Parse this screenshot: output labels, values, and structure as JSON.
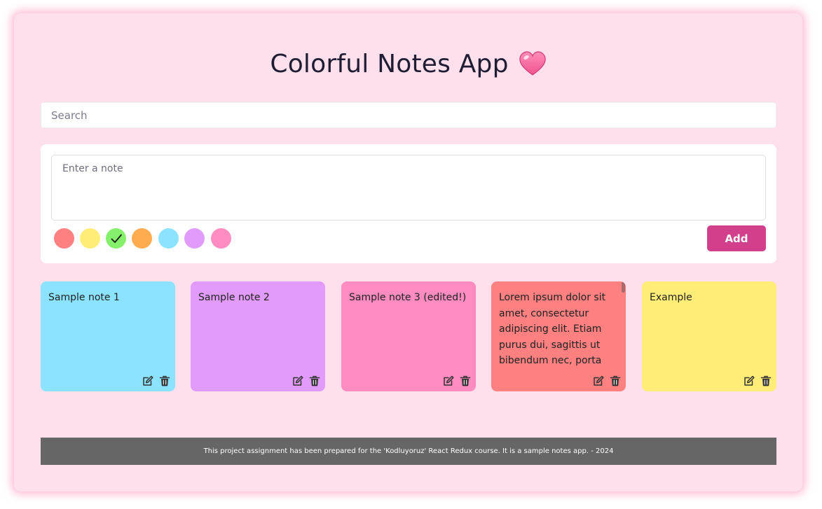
{
  "app": {
    "title": "Colorful Notes App"
  },
  "search": {
    "placeholder": "Search",
    "value": ""
  },
  "composer": {
    "placeholder": "Enter a note",
    "value": "",
    "add_label": "Add",
    "add_color": "#d23f8a",
    "colors": [
      {
        "name": "red",
        "hex": "#ff8080",
        "selected": false
      },
      {
        "name": "yellow",
        "hex": "#ffed78",
        "selected": false
      },
      {
        "name": "green",
        "hex": "#85f06b",
        "selected": true
      },
      {
        "name": "orange",
        "hex": "#ffab4f",
        "selected": false
      },
      {
        "name": "blue",
        "hex": "#8ce3ff",
        "selected": false
      },
      {
        "name": "purple",
        "hex": "#e09bfb",
        "selected": false
      },
      {
        "name": "pink",
        "hex": "#ff8cc1",
        "selected": false
      }
    ]
  },
  "notes": [
    {
      "text": "Sample note 1",
      "color": "#8ce3ff"
    },
    {
      "text": "Sample note 2",
      "color": "#e09bfb"
    },
    {
      "text": "Sample note 3 (edited!)",
      "color": "#ff8cc1"
    },
    {
      "text": "Lorem ipsum dolor sit amet, consectetur adipiscing elit. Etiam purus dui, sagittis ut bibendum nec, porta",
      "color": "#ff8080"
    },
    {
      "text": "Example",
      "color": "#ffed78"
    }
  ],
  "footer": {
    "text": "This project assignment has been prepared for the 'Kodluyoruz' React Redux course. It is a sample notes app. - 2024"
  }
}
